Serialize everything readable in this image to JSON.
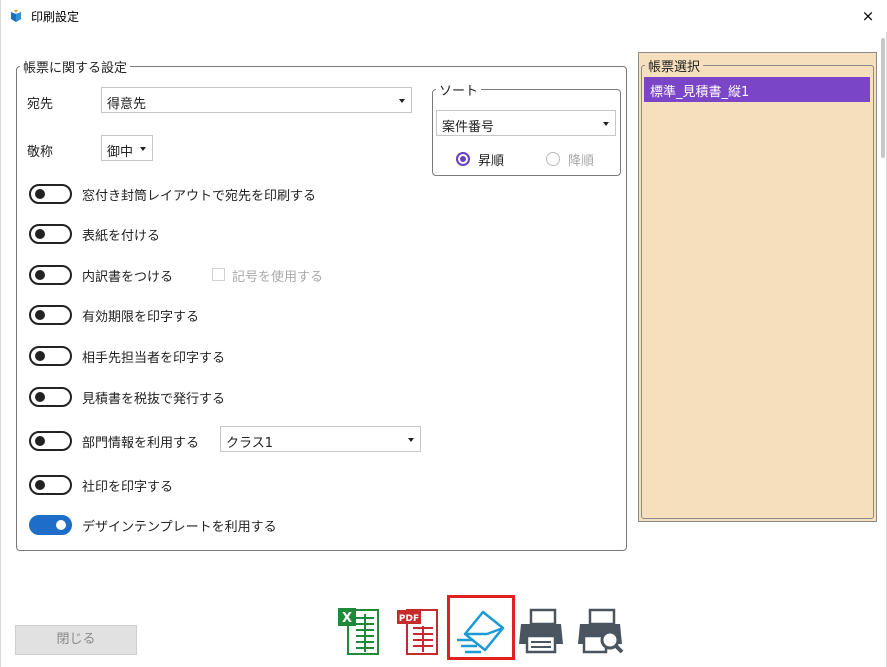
{
  "window": {
    "title": "印刷設定",
    "close_symbol": "×"
  },
  "settings": {
    "legend": "帳票に関する設定",
    "destination_label": "宛先",
    "destination_value": "得意先",
    "honorific_label": "敬称",
    "honorific_value": "御中",
    "toggles": [
      {
        "label": "窓付き封筒レイアウトで宛先を印刷する",
        "on": false
      },
      {
        "label": "表紙を付ける",
        "on": false
      },
      {
        "label": "内訳書をつける",
        "on": false
      },
      {
        "label": "有効期限を印字する",
        "on": false
      },
      {
        "label": "相手先担当者を印字する",
        "on": false
      },
      {
        "label": "見積書を税抜で発行する",
        "on": false
      },
      {
        "label": "部門情報を利用する",
        "on": false
      },
      {
        "label": "社印を印字する",
        "on": false
      },
      {
        "label": "デザインテンプレートを利用する",
        "on": true
      }
    ],
    "symbol_checkbox_label": "記号を使用する",
    "department_select_value": "クラス1"
  },
  "sort": {
    "legend": "ソート",
    "field_value": "案件番号",
    "ascending_label": "昇順",
    "descending_label": "降順",
    "selected": "ascending"
  },
  "template_panel": {
    "legend": "帳票選択",
    "items": [
      "標準_見積書_縦1"
    ]
  },
  "footer": {
    "close_label": "閉じる",
    "actions": [
      {
        "name": "excel-export",
        "text": "X"
      },
      {
        "name": "pdf-export",
        "text": "PDF"
      },
      {
        "name": "email-send",
        "highlighted": true
      },
      {
        "name": "print"
      },
      {
        "name": "print-preview"
      }
    ]
  },
  "colors": {
    "accent_purple": "#7b45c8",
    "toggle_on": "#1e6ec8",
    "panel_bg": "#f5dfbd",
    "highlight_red": "#e32020",
    "excel_green": "#1e8a3a",
    "pdf_red": "#c42b2b",
    "mail_blue": "#1a9ad6",
    "printer_gray": "#4a5560"
  }
}
